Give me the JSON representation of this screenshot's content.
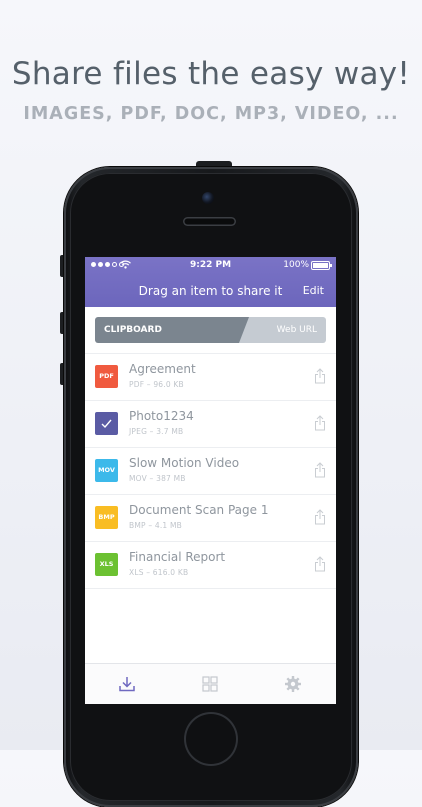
{
  "headline": "Share files the easy way!",
  "subheadline": "IMAGES, PDF, DOC, MP3, VIDEO, ...",
  "status_bar": {
    "time": "9:22 PM",
    "battery": "100%"
  },
  "nav": {
    "title": "Drag an item to share it",
    "edit_label": "Edit"
  },
  "segment": {
    "left_label": "CLIPBOARD",
    "right_label": "Web URL"
  },
  "files": [
    {
      "name": "Agreement",
      "meta": "PDF – 96.0 KB",
      "icon_label": "PDF",
      "color": "#f05a3f"
    },
    {
      "name": "Photo1234",
      "meta": "JPEG – 3.7 MB",
      "icon_label": "",
      "color": "#5a5ba4"
    },
    {
      "name": "Slow Motion Video",
      "meta": "MOV – 387 MB",
      "icon_label": "MOV",
      "color": "#3cb9ea"
    },
    {
      "name": "Document Scan Page 1",
      "meta": "BMP – 4.1 MB",
      "icon_label": "BMP",
      "color": "#f9bd23"
    },
    {
      "name": "Financial Report",
      "meta": "XLS – 616.0 KB",
      "icon_label": "XLS",
      "color": "#6cc132"
    }
  ],
  "colors": {
    "accent": "#6f69c0",
    "text_gray": "#8f969e"
  },
  "tabs": [
    "download-icon",
    "grid-icon",
    "gear-icon"
  ]
}
